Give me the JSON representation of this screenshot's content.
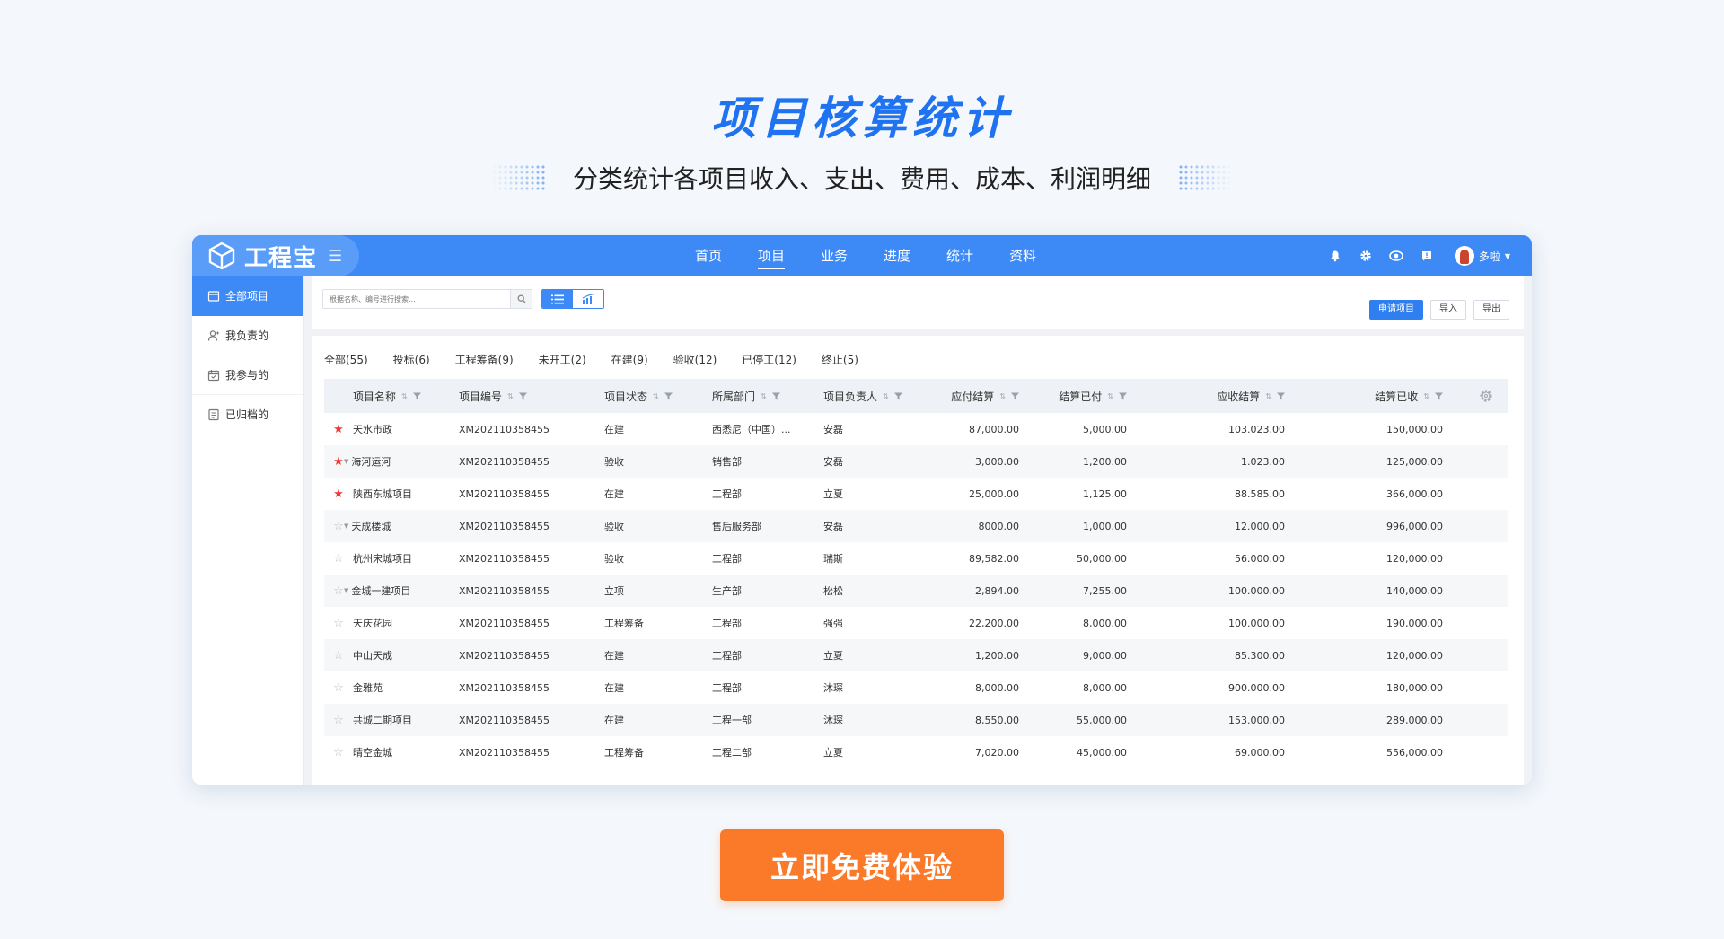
{
  "hero": {
    "title": "项目核算统计",
    "subtitle": "分类统计各项目收入、支出、费用、成本、利润明细"
  },
  "brand": {
    "name": "工程宝",
    "menu_glyph": "☰"
  },
  "nav": [
    {
      "label": "首页",
      "active": false
    },
    {
      "label": "项目",
      "active": true
    },
    {
      "label": "业务",
      "active": false
    },
    {
      "label": "进度",
      "active": false
    },
    {
      "label": "统计",
      "active": false
    },
    {
      "label": "资料",
      "active": false
    }
  ],
  "user": {
    "name": "多啦"
  },
  "sidebar": [
    {
      "label": "全部项目",
      "icon": "folder-icon",
      "active": true
    },
    {
      "label": "我负责的",
      "icon": "user-icon",
      "active": false
    },
    {
      "label": "我参与的",
      "icon": "calendar-icon",
      "active": false
    },
    {
      "label": "已归档的",
      "icon": "archive-icon",
      "active": false
    }
  ],
  "search": {
    "placeholder": "根据名称、编号进行搜索..."
  },
  "actions": {
    "apply": "申请项目",
    "import": "导入",
    "export": "导出"
  },
  "filters": [
    "全部(55)",
    "投标(6)",
    "工程筹备(9)",
    "未开工(2)",
    "在建(9)",
    "验收(12)",
    "已停工(12)",
    "终止(5)"
  ],
  "table": {
    "headers": {
      "name": "项目名称",
      "code": "项目编号",
      "status": "项目状态",
      "dept": "所属部门",
      "owner": "项目负责人",
      "yj": "应付结算",
      "yf": "结算已付",
      "ys": "应收结算",
      "ss": "结算已收"
    },
    "rows": [
      {
        "starred": true,
        "expandable": false,
        "name": "天水市政",
        "code": "XM202110358455",
        "status": "在建",
        "dept": "西悉尼（中国）...",
        "owner": "安磊",
        "yj": "87,000.00",
        "yf": "5,000.00",
        "ys": "103.023.00",
        "ss": "150,000.00"
      },
      {
        "starred": true,
        "expandable": true,
        "name": "海河运河",
        "code": "XM202110358455",
        "status": "验收",
        "dept": "销售部",
        "owner": "安磊",
        "yj": "3,000.00",
        "yf": "1,200.00",
        "ys": "1.023.00",
        "ss": "125,000.00"
      },
      {
        "starred": true,
        "expandable": false,
        "name": "陕西东城项目",
        "code": "XM202110358455",
        "status": "在建",
        "dept": "工程部",
        "owner": "立夏",
        "yj": "25,000.00",
        "yf": "1,125.00",
        "ys": "88.585.00",
        "ss": "366,000.00"
      },
      {
        "starred": false,
        "expandable": true,
        "name": "天成楼城",
        "code": "XM202110358455",
        "status": "验收",
        "dept": "售后服务部",
        "owner": "安磊",
        "yj": "8000.00",
        "yf": "1,000.00",
        "ys": "12.000.00",
        "ss": "996,000.00"
      },
      {
        "starred": false,
        "expandable": false,
        "name": "杭州宋城项目",
        "code": "XM202110358455",
        "status": "验收",
        "dept": "工程部",
        "owner": "瑞斯",
        "yj": "89,582.00",
        "yf": "50,000.00",
        "ys": "56.000.00",
        "ss": "120,000.00"
      },
      {
        "starred": false,
        "expandable": true,
        "name": "金城一建项目",
        "code": "XM202110358455",
        "status": "立项",
        "dept": "生产部",
        "owner": "松松",
        "yj": "2,894.00",
        "yf": "7,255.00",
        "ys": "100.000.00",
        "ss": "140,000.00"
      },
      {
        "starred": false,
        "expandable": false,
        "name": "天庆花园",
        "code": "XM202110358455",
        "status": "工程筹备",
        "dept": "工程部",
        "owner": "强强",
        "yj": "22,200.00",
        "yf": "8,000.00",
        "ys": "100.000.00",
        "ss": "190,000.00"
      },
      {
        "starred": false,
        "expandable": false,
        "name": "中山天成",
        "code": "XM202110358455",
        "status": "在建",
        "dept": "工程部",
        "owner": "立夏",
        "yj": "1,200.00",
        "yf": "9,000.00",
        "ys": "85.300.00",
        "ss": "120,000.00"
      },
      {
        "starred": false,
        "expandable": false,
        "name": "金雅苑",
        "code": "XM202110358455",
        "status": "在建",
        "dept": "工程部",
        "owner": "沐琛",
        "yj": "8,000.00",
        "yf": "8,000.00",
        "ys": "900.000.00",
        "ss": "180,000.00"
      },
      {
        "starred": false,
        "expandable": false,
        "name": "共城二期项目",
        "code": "XM202110358455",
        "status": "在建",
        "dept": "工程一部",
        "owner": "沐琛",
        "yj": "8,550.00",
        "yf": "55,000.00",
        "ys": "153.000.00",
        "ss": "289,000.00"
      },
      {
        "starred": false,
        "expandable": false,
        "name": "晴空金城",
        "code": "XM202110358455",
        "status": "工程筹备",
        "dept": "工程二部",
        "owner": "立夏",
        "yj": "7,020.00",
        "yf": "45,000.00",
        "ys": "69.000.00",
        "ss": "556,000.00"
      }
    ]
  },
  "cta": {
    "label": "立即免费体验"
  },
  "colors": {
    "primary": "#3d8af7",
    "title": "#1f73f1",
    "cta": "#fa7a2a",
    "star": "#ea3a3a"
  }
}
